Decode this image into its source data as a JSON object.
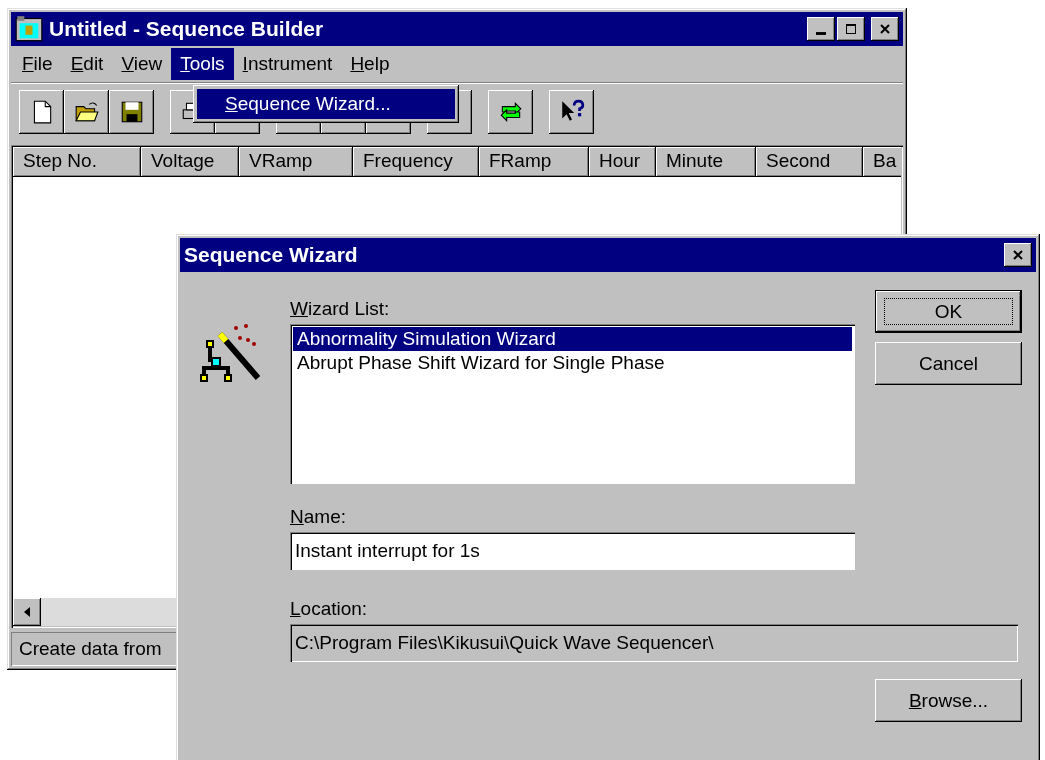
{
  "main_window": {
    "title": "Untitled - Sequence Builder",
    "menu": [
      {
        "label": "File",
        "mnemonic": true,
        "selected": false
      },
      {
        "label": "Edit",
        "mnemonic": true,
        "selected": false
      },
      {
        "label": "View",
        "mnemonic": true,
        "selected": false
      },
      {
        "label": "Tools",
        "mnemonic": true,
        "selected": true
      },
      {
        "label": "Instrument",
        "mnemonic": true,
        "selected": false
      },
      {
        "label": "Help",
        "mnemonic": true,
        "selected": false
      }
    ],
    "open_menu": {
      "items": [
        {
          "label": "Sequence Wizard...",
          "mnemonic": true,
          "selected": true
        }
      ]
    },
    "toolbar": [
      {
        "kind": "new"
      },
      {
        "kind": "open"
      },
      {
        "kind": "save"
      },
      {
        "kind": "separator"
      },
      {
        "kind": "print"
      },
      {
        "kind": "blank"
      },
      {
        "kind": "separator"
      },
      {
        "kind": "blank"
      },
      {
        "kind": "blank"
      },
      {
        "kind": "blank"
      },
      {
        "kind": "separator"
      },
      {
        "kind": "blank"
      },
      {
        "kind": "separator"
      },
      {
        "kind": "refresh"
      },
      {
        "kind": "separator"
      },
      {
        "kind": "help"
      }
    ],
    "table": {
      "columns": [
        "Step No.",
        "Voltage",
        "VRamp",
        "Frequency",
        "FRamp",
        "Hour",
        "Minute",
        "Second",
        "Ba"
      ]
    },
    "status_bar": "Create data from"
  },
  "dialog": {
    "title": "Sequence Wizard",
    "wizard_list": {
      "label": "Wizard List:",
      "mnemonic": true,
      "items": [
        {
          "label": "Abnormality Simulation Wizard",
          "selected": true
        },
        {
          "label": "Abrupt Phase Shift Wizard for Single Phase",
          "selected": false
        }
      ]
    },
    "name": {
      "label": "Name:",
      "mnemonic": true,
      "value": "Instant interrupt for 1s",
      "disabled": false
    },
    "location": {
      "label": "Location:",
      "mnemonic": true,
      "value": "C:\\Program Files\\Kikusui\\Quick Wave Sequencer\\",
      "disabled": true
    },
    "buttons": [
      {
        "label": "OK",
        "mnemonic": false,
        "default": true
      },
      {
        "label": "Cancel",
        "mnemonic": false,
        "default": false
      },
      {
        "label": "Browse...",
        "mnemonic": true,
        "default": false
      }
    ]
  }
}
